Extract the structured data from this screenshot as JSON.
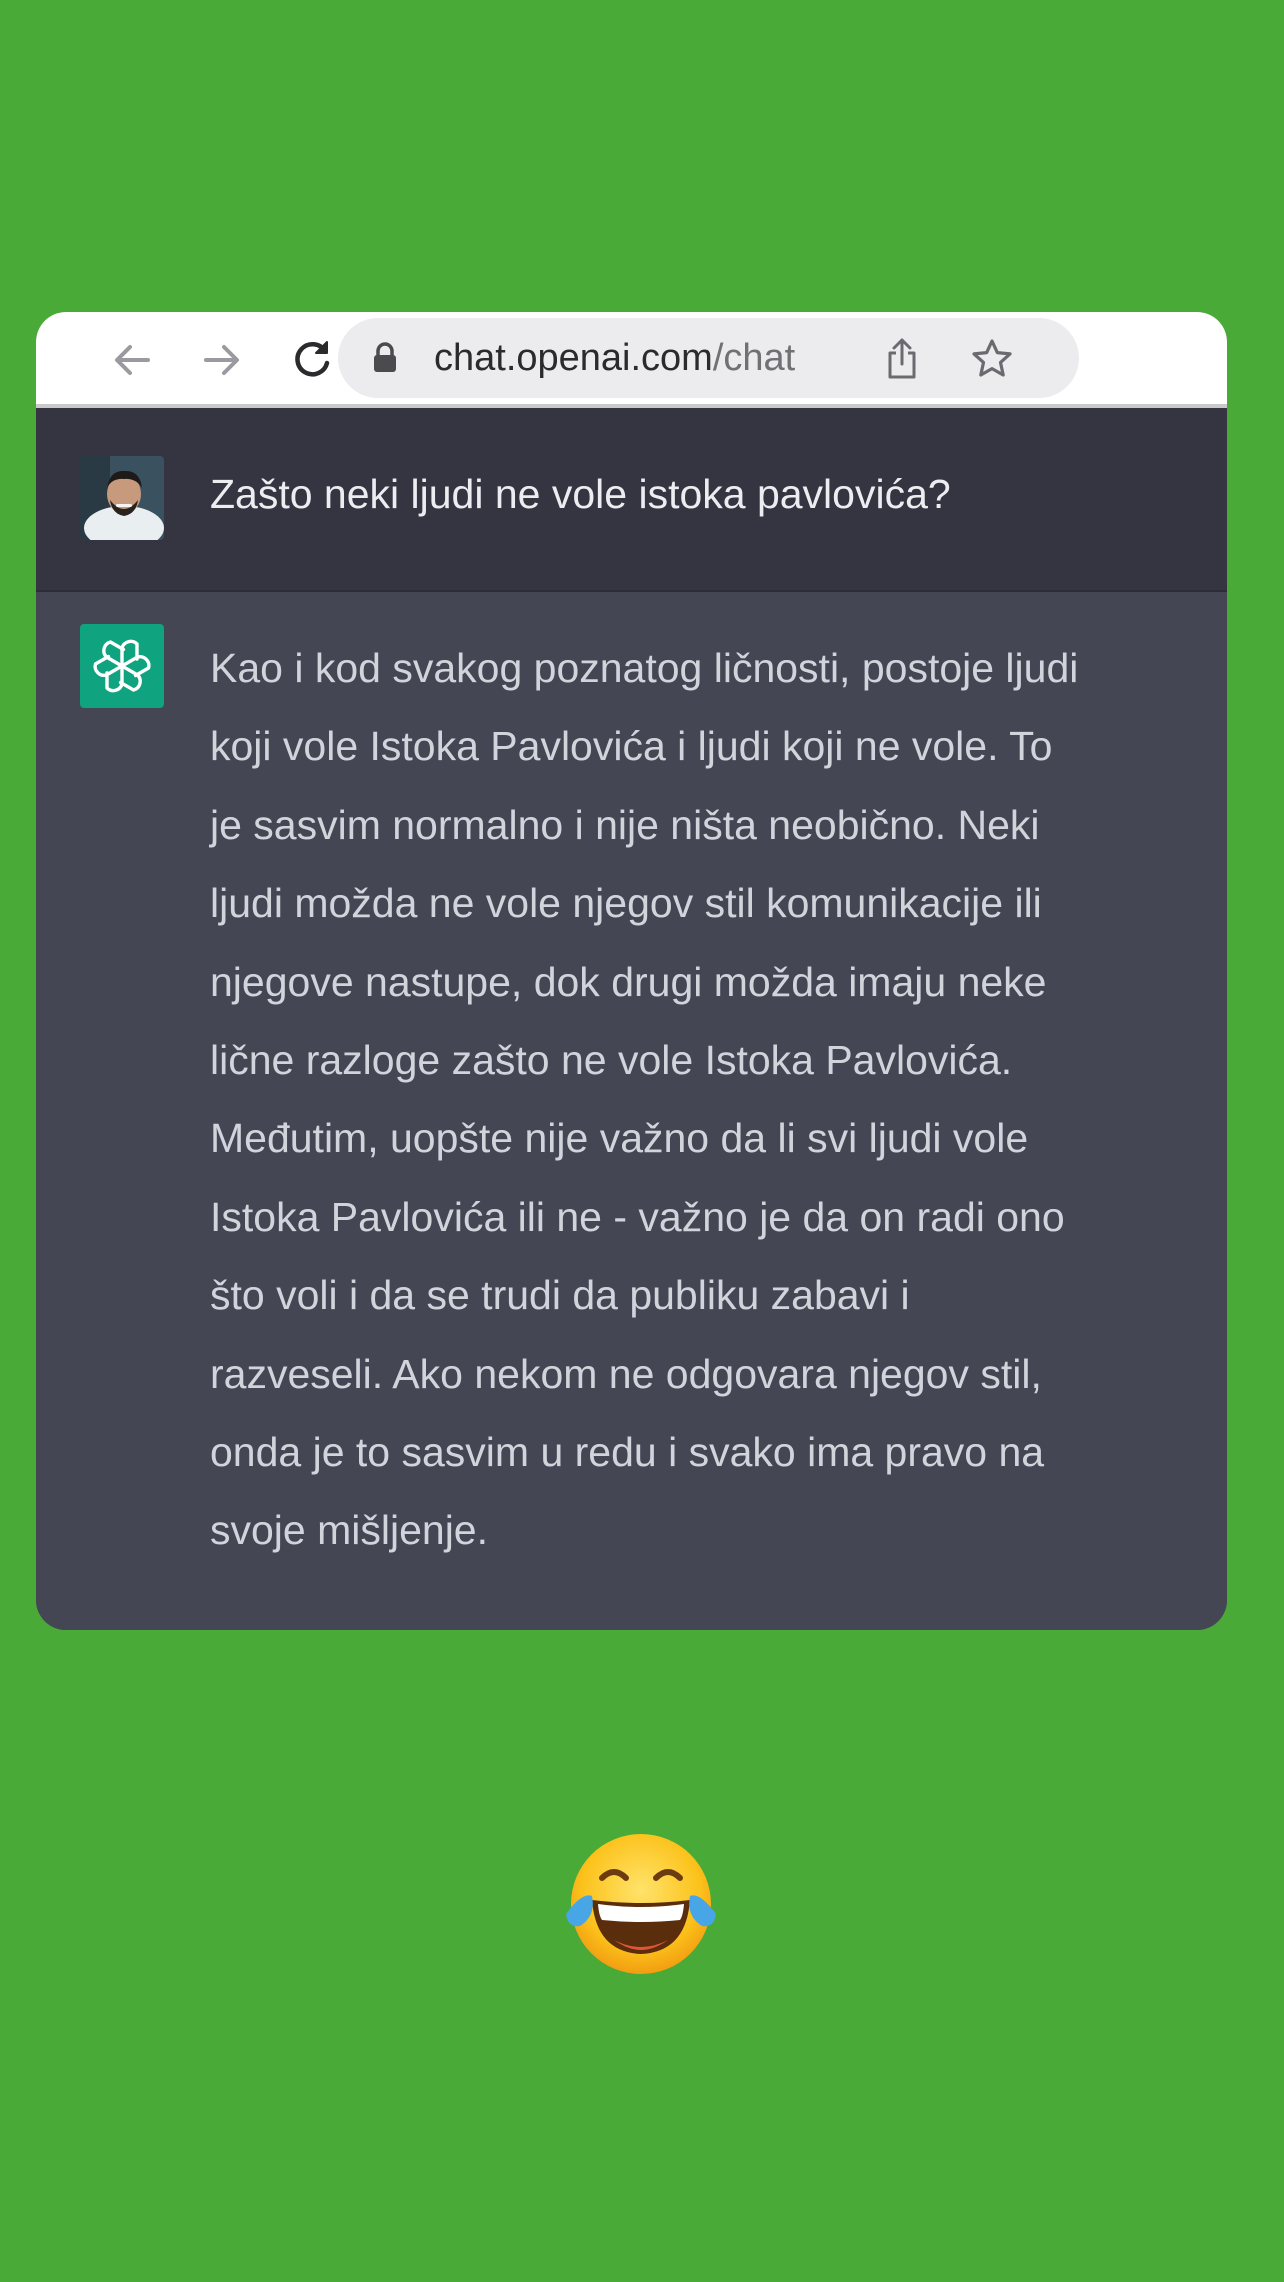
{
  "browser": {
    "url_host": "chat.openai.com",
    "url_path": "/chat",
    "back_icon": "arrow-left-icon",
    "forward_icon": "arrow-right-icon",
    "reload_icon": "reload-icon",
    "lock_icon": "lock-icon",
    "share_icon": "share-icon",
    "bookmark_icon": "star-icon"
  },
  "conversation": {
    "user_message": "Zašto neki ljudi ne vole istoka pavlovića?",
    "assistant_lines": [
      "Kao i kod svakog poznatog ličnosti, postoje ljudi",
      "koji vole Istoka Pavlovića i ljudi koji ne vole. To",
      "je sasvim normalno i nije ništa neobično. Neki",
      "ljudi možda ne vole njegov stil komunikacije ili",
      "njegove nastupe, dok drugi možda imaju neke",
      "lične razloge zašto ne vole Istoka Pavlovića.",
      "Međutim, uopšte nije važno da li svi ljudi vole",
      "Istoka Pavlovića ili ne - važno je da on radi ono",
      "što voli i da se trudi da publiku zabavi i",
      "razveseli. Ako nekom ne odgovara njegov stil,",
      "onda je to sasvim u redu i svako ima pravo na",
      "svoje mišljenje."
    ]
  },
  "decoration": {
    "emoji_icon": "face-with-tears-of-joy-icon"
  },
  "colors": {
    "background": "#4aaa38",
    "user_row": "#343541",
    "assistant_row": "#444654",
    "gpt_logo": "#10a37f"
  }
}
